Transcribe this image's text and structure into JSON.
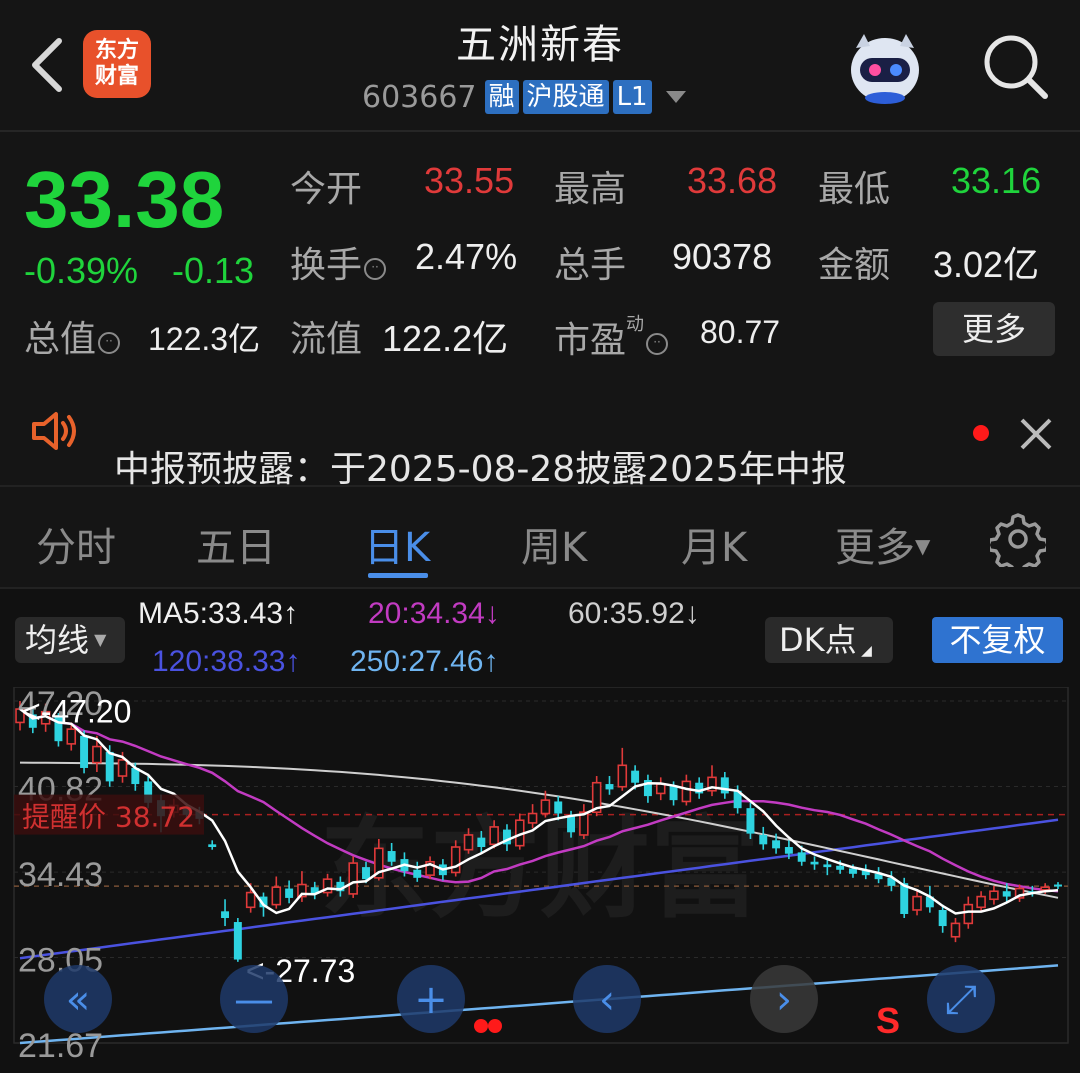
{
  "header": {
    "logo_text_line1": "东方",
    "logo_text_line2": "财富",
    "title": "五洲新春",
    "code": "603667",
    "tags": [
      "融",
      "沪股通",
      "L1"
    ]
  },
  "quote": {
    "price": "33.38",
    "change_pct": "-0.39%",
    "change_abs": "-0.13",
    "open_label": "今开",
    "open_value": "33.55",
    "high_label": "最高",
    "high_value": "33.68",
    "low_label": "最低",
    "low_value": "33.16",
    "turnover_label": "换手",
    "turnover_value": "2.47%",
    "volume_label": "总手",
    "volume_value": "90378",
    "amount_label": "金额",
    "amount_value": "3.02亿",
    "mktcap_label": "总值",
    "mktcap_value": "122.3亿",
    "float_label": "流值",
    "float_value": "122.2亿",
    "pe_label": "市盈",
    "pe_sup": "动",
    "pe_value": "80.77",
    "more_label": "更多"
  },
  "notice": {
    "text": "中报预披露：于2025-08-28披露2025年中报"
  },
  "tabs": {
    "items": [
      "分时",
      "五日",
      "日K",
      "周K",
      "月K",
      "更多"
    ],
    "active": "日K"
  },
  "chart_controls": {
    "ma_select": "均线",
    "ma5": "MA5:33.43↑",
    "ma20": "20:34.34↓",
    "ma60": "60:35.92↓",
    "ma120": "120:38.33↑",
    "ma250": "250:27.46↑",
    "dk_label": "DK点",
    "fq_label": "不复权"
  },
  "colors": {
    "up": "#e03a3a",
    "down": "#1fd43c",
    "accent": "#4a8ee8",
    "ma5": "#ffffff",
    "ma20": "#c23bc2",
    "ma60": "#cfcfcf",
    "ma120": "#4a52e0",
    "ma250": "#6fb4f0"
  },
  "chart_data": {
    "type": "candlestick",
    "y_ticks": [
      "47.20",
      "40.82",
      "34.43",
      "28.05",
      "21.67"
    ],
    "ylim": [
      21.67,
      47.2
    ],
    "alert_label": "提醒价 38.72",
    "alert_price": 38.72,
    "max_marker": "<-47.20",
    "min_marker": "<-27.73",
    "watermark": "东方财富",
    "signal_mark": "S",
    "candles": [
      {
        "o": 45.6,
        "c": 46.6,
        "h": 47.2,
        "l": 45.0
      },
      {
        "o": 46.2,
        "c": 45.2,
        "h": 46.8,
        "l": 44.8
      },
      {
        "o": 45.5,
        "c": 46.4,
        "h": 47.0,
        "l": 44.9
      },
      {
        "o": 46.0,
        "c": 44.2,
        "h": 46.3,
        "l": 43.8
      },
      {
        "o": 44.0,
        "c": 45.1,
        "h": 45.6,
        "l": 43.5
      },
      {
        "o": 44.6,
        "c": 42.2,
        "h": 45.0,
        "l": 41.8
      },
      {
        "o": 42.6,
        "c": 43.8,
        "h": 44.6,
        "l": 41.9
      },
      {
        "o": 43.4,
        "c": 41.2,
        "h": 43.9,
        "l": 40.8
      },
      {
        "o": 41.6,
        "c": 42.8,
        "h": 43.4,
        "l": 41.1
      },
      {
        "o": 42.2,
        "c": 41.0,
        "h": 42.6,
        "l": 40.5
      },
      {
        "o": 41.2,
        "c": 39.6,
        "h": 41.6,
        "l": 39.2
      },
      {
        "o": 39.8,
        "c": 38.6,
        "h": 40.2,
        "l": 37.4
      },
      {
        "o": 38.9,
        "c": 39.4,
        "h": 39.9,
        "l": 38.5
      },
      {
        "o": 39.3,
        "c": 38.7,
        "h": 39.6,
        "l": 38.4
      },
      {
        "o": 39.0,
        "c": 38.4,
        "h": 39.3,
        "l": 38.0
      },
      {
        "o": 36.5,
        "c": 36.3,
        "h": 36.8,
        "l": 36.1
      },
      {
        "o": 31.5,
        "c": 31.0,
        "h": 32.4,
        "l": 30.4
      },
      {
        "o": 30.7,
        "c": 27.9,
        "h": 31.0,
        "l": 27.73
      },
      {
        "o": 31.8,
        "c": 32.9,
        "h": 33.6,
        "l": 31.4
      },
      {
        "o": 32.6,
        "c": 31.8,
        "h": 32.9,
        "l": 31.1
      },
      {
        "o": 32.0,
        "c": 33.3,
        "h": 34.1,
        "l": 31.7
      },
      {
        "o": 33.2,
        "c": 32.5,
        "h": 33.8,
        "l": 32.1
      },
      {
        "o": 32.6,
        "c": 33.5,
        "h": 34.5,
        "l": 32.2
      },
      {
        "o": 33.3,
        "c": 32.8,
        "h": 33.7,
        "l": 32.4
      },
      {
        "o": 32.9,
        "c": 33.9,
        "h": 34.3,
        "l": 32.6
      },
      {
        "o": 33.7,
        "c": 33.0,
        "h": 34.1,
        "l": 32.6
      },
      {
        "o": 32.8,
        "c": 35.1,
        "h": 35.6,
        "l": 32.5
      },
      {
        "o": 34.8,
        "c": 33.9,
        "h": 35.2,
        "l": 33.6
      },
      {
        "o": 34.0,
        "c": 36.2,
        "h": 36.9,
        "l": 33.8
      },
      {
        "o": 36.0,
        "c": 35.2,
        "h": 36.6,
        "l": 34.9
      },
      {
        "o": 35.4,
        "c": 34.5,
        "h": 35.9,
        "l": 34.1
      },
      {
        "o": 34.6,
        "c": 34.0,
        "h": 35.2,
        "l": 33.7
      },
      {
        "o": 34.2,
        "c": 35.2,
        "h": 35.6,
        "l": 33.9
      },
      {
        "o": 35.0,
        "c": 34.2,
        "h": 35.4,
        "l": 33.8
      },
      {
        "o": 34.4,
        "c": 36.3,
        "h": 36.8,
        "l": 34.1
      },
      {
        "o": 36.1,
        "c": 37.2,
        "h": 37.7,
        "l": 35.8
      },
      {
        "o": 37.0,
        "c": 36.3,
        "h": 37.5,
        "l": 35.9
      },
      {
        "o": 36.5,
        "c": 37.8,
        "h": 38.3,
        "l": 36.2
      },
      {
        "o": 37.6,
        "c": 36.5,
        "h": 38.0,
        "l": 36.0
      },
      {
        "o": 36.4,
        "c": 38.3,
        "h": 38.8,
        "l": 36.1
      },
      {
        "o": 38.1,
        "c": 38.8,
        "h": 39.5,
        "l": 37.7
      },
      {
        "o": 38.8,
        "c": 39.8,
        "h": 40.5,
        "l": 38.5
      },
      {
        "o": 39.7,
        "c": 38.8,
        "h": 40.1,
        "l": 38.3
      },
      {
        "o": 38.6,
        "c": 37.4,
        "h": 39.0,
        "l": 37.0
      },
      {
        "o": 37.2,
        "c": 38.9,
        "h": 39.5,
        "l": 36.9
      },
      {
        "o": 38.9,
        "c": 41.1,
        "h": 41.6,
        "l": 38.6
      },
      {
        "o": 41.0,
        "c": 40.6,
        "h": 41.6,
        "l": 40.2
      },
      {
        "o": 40.8,
        "c": 42.4,
        "h": 43.7,
        "l": 40.5
      },
      {
        "o": 42.0,
        "c": 41.1,
        "h": 42.4,
        "l": 40.6
      },
      {
        "o": 41.3,
        "c": 40.1,
        "h": 41.7,
        "l": 39.6
      },
      {
        "o": 40.3,
        "c": 41.0,
        "h": 41.5,
        "l": 39.8
      },
      {
        "o": 40.9,
        "c": 39.8,
        "h": 41.2,
        "l": 39.4
      },
      {
        "o": 39.7,
        "c": 41.2,
        "h": 41.7,
        "l": 39.4
      },
      {
        "o": 41.1,
        "c": 40.3,
        "h": 41.5,
        "l": 39.9
      },
      {
        "o": 40.5,
        "c": 41.5,
        "h": 42.4,
        "l": 40.1
      },
      {
        "o": 41.5,
        "c": 40.3,
        "h": 41.9,
        "l": 39.9
      },
      {
        "o": 40.5,
        "c": 39.2,
        "h": 40.9,
        "l": 38.8
      },
      {
        "o": 39.2,
        "c": 37.3,
        "h": 39.6,
        "l": 36.9
      },
      {
        "o": 37.2,
        "c": 36.5,
        "h": 37.8,
        "l": 36.1
      },
      {
        "o": 36.8,
        "c": 36.2,
        "h": 37.3,
        "l": 35.8
      },
      {
        "o": 36.3,
        "c": 35.8,
        "h": 36.8,
        "l": 35.4
      },
      {
        "o": 35.9,
        "c": 35.2,
        "h": 36.4,
        "l": 34.9
      },
      {
        "o": 35.2,
        "c": 35.0,
        "h": 35.6,
        "l": 34.6
      },
      {
        "o": 35.0,
        "c": 34.8,
        "h": 35.4,
        "l": 34.2
      },
      {
        "o": 34.9,
        "c": 34.6,
        "h": 35.3,
        "l": 34.3
      },
      {
        "o": 34.7,
        "c": 34.3,
        "h": 35.0,
        "l": 34.0
      },
      {
        "o": 34.6,
        "c": 34.2,
        "h": 35.0,
        "l": 33.9
      },
      {
        "o": 34.3,
        "c": 33.9,
        "h": 34.8,
        "l": 33.6
      },
      {
        "o": 34.0,
        "c": 33.4,
        "h": 34.5,
        "l": 33.0
      },
      {
        "o": 33.6,
        "c": 31.3,
        "h": 34.0,
        "l": 31.0
      },
      {
        "o": 31.6,
        "c": 32.6,
        "h": 33.1,
        "l": 31.2
      },
      {
        "o": 32.6,
        "c": 31.8,
        "h": 33.4,
        "l": 31.4
      },
      {
        "o": 31.6,
        "c": 30.4,
        "h": 32.0,
        "l": 29.9
      },
      {
        "o": 29.6,
        "c": 30.6,
        "h": 31.0,
        "l": 29.2
      },
      {
        "o": 30.6,
        "c": 32.0,
        "h": 32.6,
        "l": 30.2
      },
      {
        "o": 31.8,
        "c": 32.6,
        "h": 33.0,
        "l": 31.5
      },
      {
        "o": 32.4,
        "c": 33.0,
        "h": 33.4,
        "l": 32.0
      },
      {
        "o": 33.0,
        "c": 32.6,
        "h": 33.6,
        "l": 32.2
      },
      {
        "o": 32.5,
        "c": 33.2,
        "h": 33.5,
        "l": 32.2
      },
      {
        "o": 33.0,
        "c": 32.9,
        "h": 33.4,
        "l": 32.6
      },
      {
        "o": 33.1,
        "c": 33.3,
        "h": 33.6,
        "l": 32.8
      },
      {
        "o": 33.5,
        "c": 33.38,
        "h": 33.68,
        "l": 33.16
      }
    ]
  },
  "overlay_buttons": [
    "fast-rewind",
    "zoom-out",
    "zoom-in",
    "prev",
    "next",
    "fullscreen"
  ]
}
